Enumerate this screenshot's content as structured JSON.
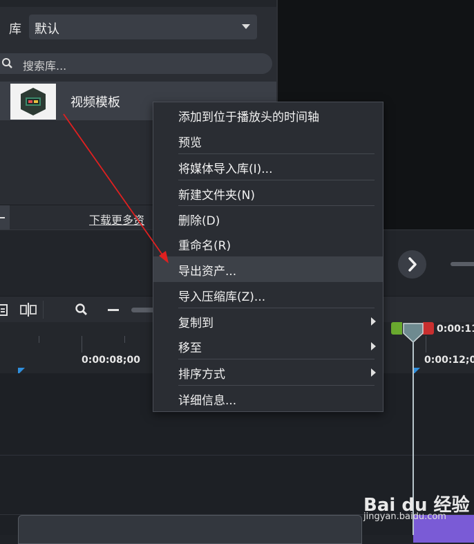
{
  "library": {
    "label": "库",
    "selected": "默认",
    "search_placeholder": "搜索库...",
    "item_label": "视频模板",
    "download_link": "下载更多资"
  },
  "context_menu": {
    "items": [
      {
        "label": "添加到位于播放头的时间轴"
      },
      {
        "label": "预览"
      },
      {
        "label": "将媒体导入库(I)..."
      },
      {
        "label": "新建文件夹(N)"
      },
      {
        "label": "删除(D)"
      },
      {
        "label": "重命名(R)"
      },
      {
        "label": "导出资产..."
      },
      {
        "label": "导入压缩库(Z)..."
      },
      {
        "label": "复制到"
      },
      {
        "label": "移至"
      },
      {
        "label": "排序方式"
      },
      {
        "label": "详细信息..."
      }
    ],
    "highlighted_index": 6
  },
  "timeline": {
    "times": [
      "0:00:08;00",
      "0:00:12;00",
      "0:00:11;"
    ]
  },
  "watermark": {
    "logo": "Bai du 经验",
    "url": "jingyan.baidu.com"
  },
  "colors": {
    "annotation_arrow": "#e02020",
    "clip_purple": "#7a5bd6"
  }
}
